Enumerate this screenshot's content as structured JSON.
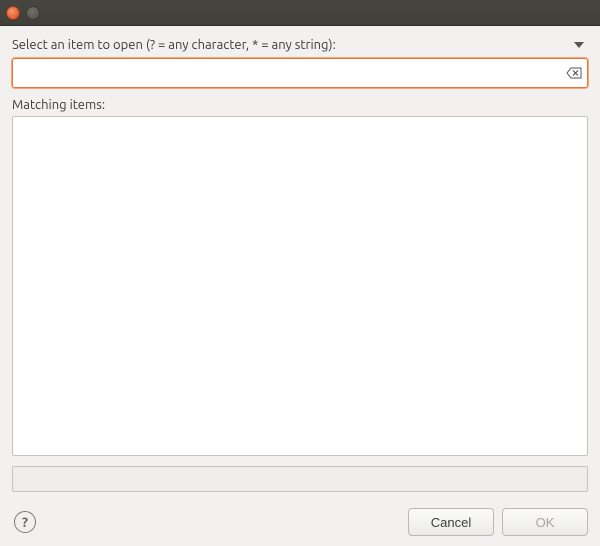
{
  "prompt": {
    "label": "Select an item to open (? = any character, * = any string):"
  },
  "search": {
    "value": "",
    "placeholder": ""
  },
  "matching": {
    "label": "Matching items:",
    "items": []
  },
  "status": {
    "text": ""
  },
  "buttons": {
    "cancel": "Cancel",
    "ok": "OK"
  }
}
